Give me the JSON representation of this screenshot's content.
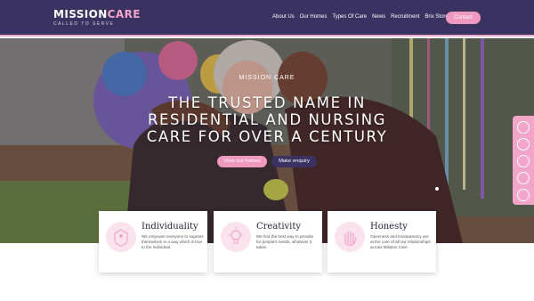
{
  "header": {
    "logo_main": "MISSION",
    "logo_accent": "CARE",
    "logo_sub": "CALLED TO SERVE",
    "nav": [
      "About Us",
      "Our Homes",
      "Types Of Care",
      "News",
      "Recruitment",
      "Brix Store"
    ],
    "contact_label": "Contact"
  },
  "hero": {
    "tagline": "MISSION CARE",
    "title": "THE TRUSTED NAME IN RESIDENTIAL AND NURSING CARE FOR OVER A CENTURY",
    "view_homes_label": "View our homes",
    "make_enquiry_label": "Make enquiry"
  },
  "side_icons": [
    "instagram-icon",
    "person-icon",
    "location-icon",
    "heart-icon",
    "mail-icon"
  ],
  "cards": [
    {
      "title": "Individuality",
      "text": "We empower everyone to express themselves in a way which is true to the individual.",
      "icon": "individuality-icon"
    },
    {
      "title": "Creativity",
      "text": "We find the best way to provide for people's needs, whatever it takes.",
      "icon": "lightbulb-icon"
    },
    {
      "title": "Honesty",
      "text": "Openness and transparency are at the core of all our relationships across Mission Care.",
      "icon": "hand-icon"
    }
  ],
  "colors": {
    "brand_purple": "#3a3260",
    "brand_pink": "#ef98c0",
    "light_pink": "#fbe3ee"
  }
}
